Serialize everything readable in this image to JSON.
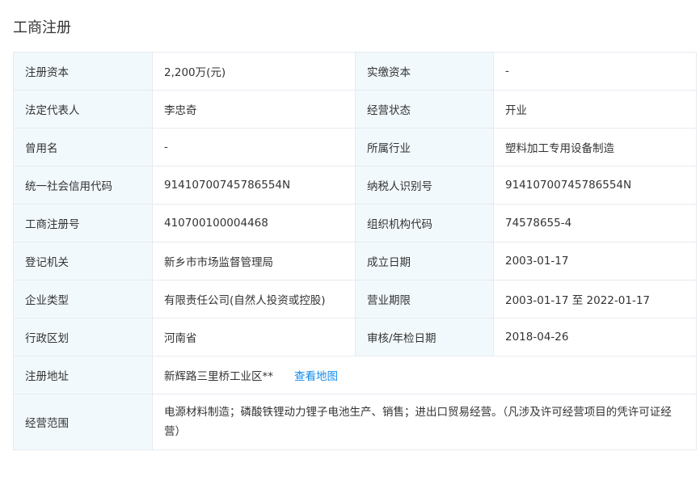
{
  "section": {
    "title": "工商注册"
  },
  "rows": [
    {
      "l1": "注册资本",
      "v1": "2,200万(元)",
      "l2": "实缴资本",
      "v2": "-"
    },
    {
      "l1": "法定代表人",
      "v1": "李忠奇",
      "l2": "经营状态",
      "v2": "开业"
    },
    {
      "l1": "曾用名",
      "v1": "-",
      "l2": "所属行业",
      "v2": "塑料加工专用设备制造"
    },
    {
      "l1": "统一社会信用代码",
      "v1": "91410700745786554N",
      "l2": "纳税人识别号",
      "v2": "91410700745786554N"
    },
    {
      "l1": "工商注册号",
      "v1": "410700100004468",
      "l2": "组织机构代码",
      "v2": "74578655-4"
    },
    {
      "l1": "登记机关",
      "v1": "新乡市市场监督管理局",
      "l2": "成立日期",
      "v2": "2003-01-17"
    },
    {
      "l1": "企业类型",
      "v1": "有限责任公司(自然人投资或控股)",
      "l2": "营业期限",
      "v2": "2003-01-17 至 2022-01-17"
    },
    {
      "l1": "行政区划",
      "v1": "河南省",
      "l2": "审核/年检日期",
      "v2": "2018-04-26"
    }
  ],
  "address": {
    "label": "注册地址",
    "value": "新辉路三里桥工业区**",
    "map_link": "查看地图"
  },
  "scope": {
    "label": "经营范围",
    "value": "电源材料制造；磷酸铁锂动力锂子电池生产、销售；进出口贸易经营。（凡涉及许可经营项目的凭许可证经营）"
  }
}
